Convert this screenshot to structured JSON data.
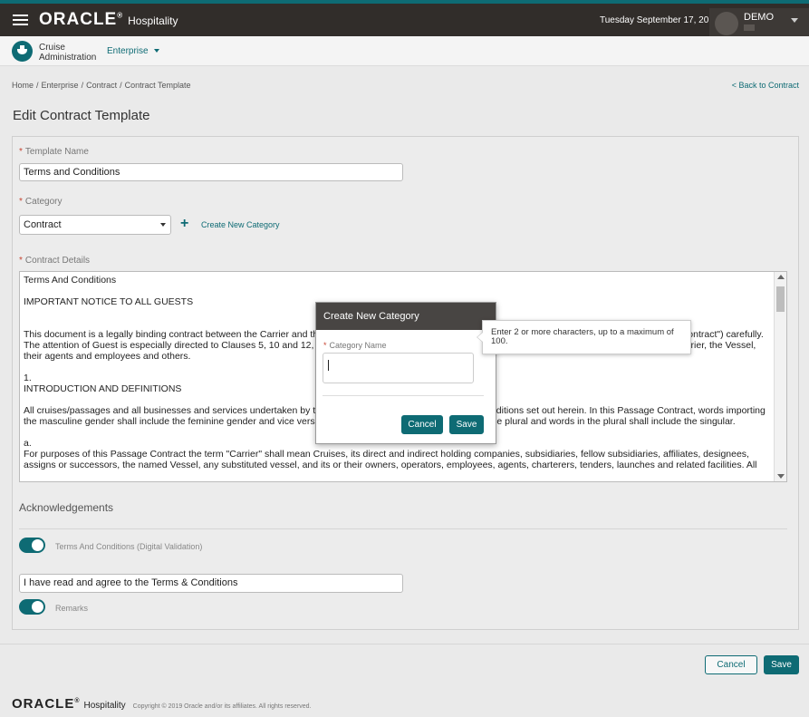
{
  "header": {
    "brand_name": "ORACLE",
    "brand_registered": "®",
    "brand_product": "Hospitality",
    "date": "Tuesday September 17, 2019",
    "user_name": "DEMO",
    "icons": [
      "hamburger-menu-icon",
      "chevron-down-icon"
    ]
  },
  "subheader": {
    "app_name_line1": "Cruise",
    "app_name_line2": "Administration",
    "environment": "Enterprise",
    "icons": [
      "cruise-ship-icon",
      "chevron-down-icon"
    ]
  },
  "breadcrumb": {
    "items": [
      "Home",
      "Enterprise",
      "Contract",
      "Contract Template"
    ],
    "separator": "/",
    "back_link": "< Back to Contract"
  },
  "page_title": "Edit Contract Template",
  "form": {
    "template_name": {
      "label": "Template Name",
      "value": "Terms and Conditions"
    },
    "category": {
      "label": "Category",
      "value": "Contract",
      "create_link": "Create New Category",
      "icons": [
        "plus-icon"
      ]
    },
    "contract_details": {
      "label": "Contract Details",
      "paragraphs": [
        "Terms And Conditions",
        "IMPORTANT NOTICE TO ALL GUESTS",
        "This document is a legally binding contract between the Carrier and the Guest. Please read the terms and conditions of this contract carefully (the \"Passage Contract\") carefully. The attention of Guest is especially directed to Clauses 5, 10 and 12, which contain important limitations on the rights of Guest to assert claims against the Carrier, the Vessel, their agents and employees and others.",
        "1.\nINTRODUCTION AND DEFINITIONS",
        "All cruises/passages and all businesses and services undertaken by the Carrier are subject to the terms and conditions set out herein. In this Passage Contract, words importing the masculine gender shall include the feminine gender and vice versa, and words in the singular shall include the plural and words in the plural shall include the singular.",
        "a.\nFor purposes of this Passage Contract the term \"Carrier\" shall mean Cruises, its direct and indirect holding companies, subsidiaries, fellow subsidiaries, affiliates, designees, assigns or successors, the named Vessel, any substituted vessel, and its or their owners, operators, employees, agents, charterers, tenders, launches and related facilities. All"
      ]
    },
    "acknowledgements": {
      "title": "Acknowledgements",
      "digital_validation": {
        "label": "Terms And Conditions (Digital Validation)",
        "enabled": true
      },
      "agreement_text": "I have read and agree to the Terms & Conditions",
      "remarks": {
        "label": "Remarks",
        "enabled": true
      }
    }
  },
  "footer_actions": {
    "cancel": "Cancel",
    "save": "Save"
  },
  "copyright": {
    "brand_name": "ORACLE",
    "brand_registered": "®",
    "brand_product": "Hospitality",
    "text": "Copyright © 2019 Oracle and/or its affiliates. All rights reserved."
  },
  "modal": {
    "title": "Create New Category",
    "field_label": "Category Name",
    "field_value": "",
    "cancel": "Cancel",
    "save": "Save",
    "tooltip": "Enter 2 or more characters, up to a maximum of 100."
  },
  "colors": {
    "accent": "#0e6b74",
    "topbar": "#312d2a",
    "required": "#c74634"
  }
}
